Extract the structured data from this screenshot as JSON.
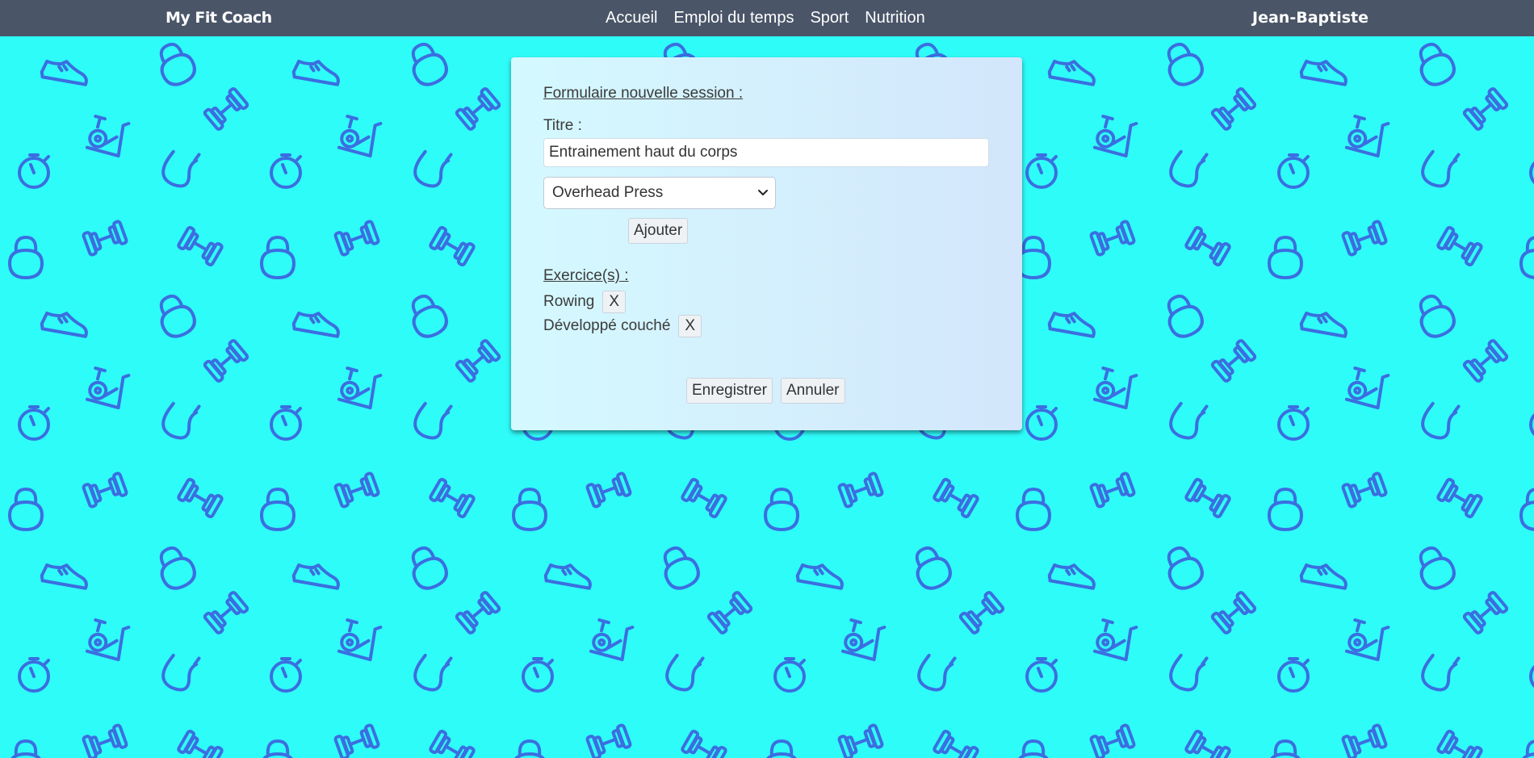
{
  "header": {
    "brand": "My Fit Coach",
    "nav": [
      "Accueil",
      "Emploi du temps",
      "Sport",
      "Nutrition"
    ],
    "user": "Jean-Baptiste"
  },
  "form": {
    "heading": "Formulaire nouvelle session :",
    "title_label": "Titre :",
    "title_value": "Entrainement haut du corps",
    "select_value": "Overhead Press",
    "add_label": "Ajouter",
    "exercises_heading": "Exercice(s) :",
    "exercises": [
      {
        "name": "Rowing",
        "remove_label": "X"
      },
      {
        "name": "Développé couché",
        "remove_label": "X"
      }
    ],
    "save_label": "Enregistrer",
    "cancel_label": "Annuler"
  },
  "colors": {
    "background": "#2efcf9",
    "pattern_stroke": "#3b6ee0",
    "topbar": "#4a5568"
  },
  "background_pattern_icons": [
    "sneaker-icon",
    "kettlebell-icon",
    "dumbbell-icon",
    "exercise-bike-icon",
    "stopwatch-icon",
    "jump-rope-icon"
  ]
}
